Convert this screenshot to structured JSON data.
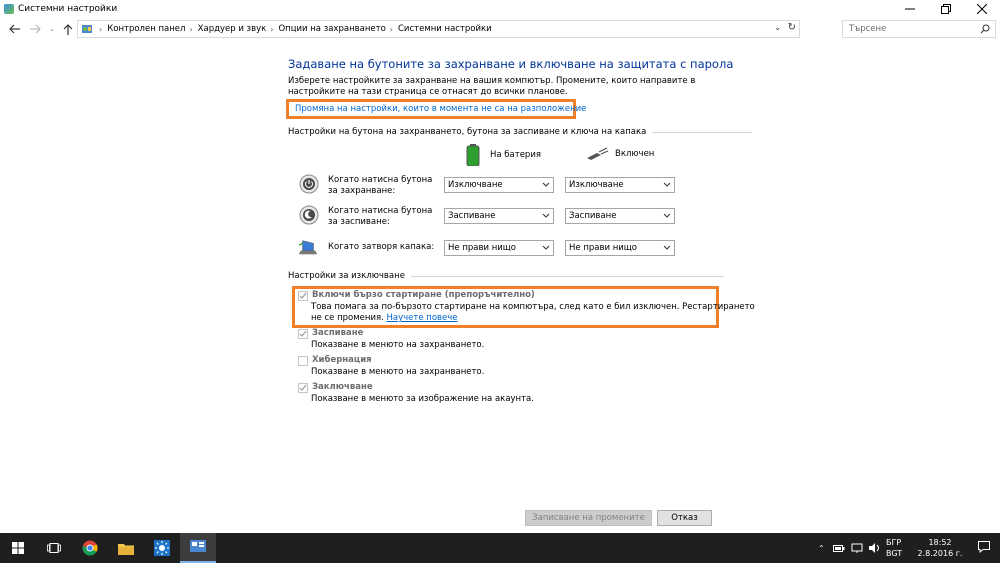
{
  "window": {
    "title": "Системни настройки"
  },
  "address": {
    "crumbs": [
      "Контролен панел",
      "Хардуер и звук",
      "Опции на захранването",
      "Системни настройки"
    ],
    "search_placeholder": "Търсене"
  },
  "page": {
    "heading": "Задаване на бутоните за захранване и включване на защитата с парола",
    "intro": "Изберете настройките за захранване на вашия компютър. Промените, които направите в настройките на тази страница се отнасят до всички планове.",
    "change_link": "Промяна на настройки, които в момента не са на разположение"
  },
  "power_buttons": {
    "section_title": "Настройки на бутона на захранването, бутона за заспиване и ключа на капака",
    "col_battery": "На батерия",
    "col_plugged": "Включен",
    "rows": [
      {
        "label": "Когато натисна бутона за захранване:",
        "battery": "Изключване",
        "plugged": "Изключване"
      },
      {
        "label": "Когато натисна бутона за заспиване:",
        "battery": "Заспиване",
        "plugged": "Заспиване"
      },
      {
        "label": "Когато затворя капака:",
        "battery": "Не прави нищо",
        "plugged": "Не прави нищо"
      }
    ]
  },
  "shutdown": {
    "section_title": "Настройки за изключване",
    "items": [
      {
        "label": "Включи бързо стартиране (препоръчително)",
        "checked": true,
        "desc1": "Това помага за по-бързото стартиране на компютъра, след като е бил изключен. Рестартирането",
        "desc2": "не се промения.",
        "link": "Научете повече"
      },
      {
        "label": "Заспиване",
        "checked": true,
        "desc1": "Показване в менюто на захранването."
      },
      {
        "label": "Хибернация",
        "checked": false,
        "desc1": "Показване в менюто на захранването."
      },
      {
        "label": "Заключване",
        "checked": true,
        "desc1": "Показване в менюто за изображение на акаунта."
      }
    ]
  },
  "buttons": {
    "save": "Записване на промените",
    "cancel": "Отказ"
  },
  "taskbar": {
    "lang_top": "БГР",
    "lang_bottom": "BGT",
    "time": "18:52",
    "date": "2.8.2016 г."
  }
}
